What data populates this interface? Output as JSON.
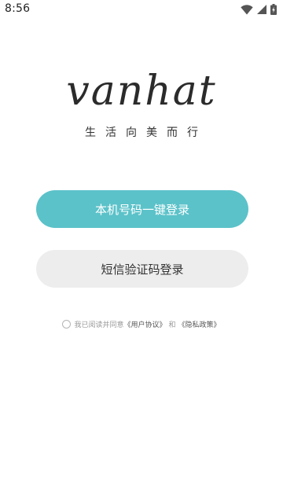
{
  "status_bar": {
    "time": "8:56",
    "icons": [
      "wifi-icon",
      "signal-icon",
      "battery-icon"
    ]
  },
  "logo": {
    "wordmark": "vanhat",
    "slogan": "生活向美而行"
  },
  "buttons": {
    "one_click_login": "本机号码一键登录",
    "sms_login": "短信验证码登录"
  },
  "agreement": {
    "prefix": "我已阅读并同意",
    "user_agreement": "《用户协议》",
    "conjunction": "和",
    "privacy_policy": "《隐私政策》",
    "checked": false
  },
  "colors": {
    "primary": "#5bc2c9",
    "secondary_bg": "#ededed",
    "text_muted": "#9a9a9a"
  }
}
